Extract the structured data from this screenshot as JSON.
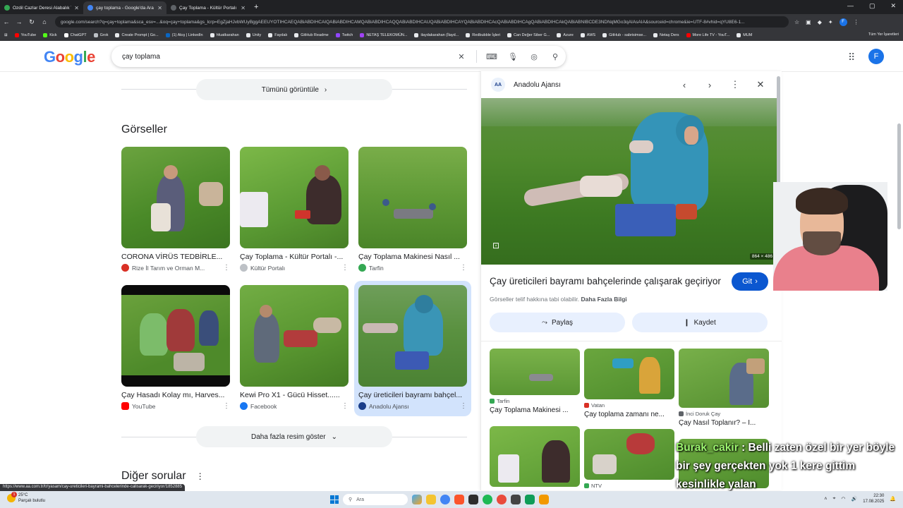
{
  "browser": {
    "tabs": [
      {
        "title": "Özdil Cazlar Deresi Alabalık Te...",
        "color": "#34a853",
        "active": false
      },
      {
        "title": "çay toplama - Google'da Ara",
        "color": "#4285f4",
        "active": true
      },
      {
        "title": "Çay Toplama - Kültür Portalı - T...",
        "color": "#202124",
        "active": false
      }
    ],
    "url": "google.com/search?q=çay+toplama&sca_esv=...&oq=çay+toplama&gs_lcrp=EgZjaHJvbWUyBggAEEUYOTIHCAEQABiABDIHCAIQABiABDIHCAMQABiABDIHCAQQABiABDIHCAUQABiABDIHCAYQABiABDIHCAcQABiABDIHCAgQABiABDIHCAkQABiABNIBCDE3NDNqMGo3qAIAsAIA&sourceid=chrome&ie=UTF-8#vhid=qYU8E6-1...",
    "bookmarks": [
      "YouTube",
      "Kick",
      "ChatGPT",
      "Grok",
      "Create Prompt | Go...",
      "(1) Akış | LinkedIn",
      "hfuatkarahan",
      "Unity",
      "Faydalı",
      "GitHub Readme",
      "Twitch",
      "NETAŞ TELEKOMÜN...",
      "ilaydakarahan (İlayd...",
      "Redbubble İşleri",
      "Can Değer Siber G...",
      "Azure",
      "AWS",
      "GitHub - sabrisimse...",
      "Netaş Ders",
      "More Life TV - YouT...",
      "MUM"
    ],
    "bookmarks_right": "Tüm Yer İşaretleri",
    "status_url": "https://www.aa.com.tr/tr/yasam/cay-ureticileri-bayrami-bahcelerinde-calisarak-geciriyor/1852885"
  },
  "google": {
    "logo": [
      "G",
      "o",
      "o",
      "g",
      "l",
      "e"
    ],
    "logo_colors": [
      "#4285f4",
      "#ea4335",
      "#fbbc05",
      "#4285f4",
      "#34a853",
      "#ea4335"
    ],
    "query": "çay toplama",
    "avatar_letter": "F"
  },
  "main": {
    "show_all": "Tümünü görüntüle",
    "section_title": "Görseller",
    "images": [
      {
        "caption": "CORONA VİRÜS TEDBİRLE...",
        "source": "Rize İl Tarım ve Orman M...",
        "source_color": "#d93025",
        "selected": false
      },
      {
        "caption": "Çay Toplama - Kültür Portalı -...",
        "source": "Kültür Portalı",
        "source_color": "#9aa0a6",
        "selected": false
      },
      {
        "caption": "Çay Toplama Makinesi Nasıl ...",
        "source": "Tarfin",
        "source_color": "#34a853",
        "selected": false
      },
      {
        "caption": "Çay Hasadı Kolay mı, Harves...",
        "source": "YouTube",
        "source_color": "#ff0000",
        "selected": false
      },
      {
        "caption": "Kewi Pro X1 - Gücü Hisset......",
        "source": "Facebook",
        "source_color": "#1877f2",
        "selected": false
      },
      {
        "caption": "Çay üreticileri bayramı bahçel...",
        "source": "Anadolu Ajansı",
        "source_color": "#1a3e8a",
        "selected": true
      }
    ],
    "more_images": "Daha fazla resim göster",
    "other_questions": "Diğer sorular"
  },
  "panel": {
    "source": "Anadolu Ajansı",
    "source_logo": "AA",
    "image_dims": "864 × 486",
    "title": "Çay üreticileri bayramı bahçelerinde çalışarak geçiriyor",
    "visit_label": "Git",
    "copyright": "Görseller telif hakkına tabi olabilir.",
    "more_info": "Daha Fazla Bilgi",
    "share_label": "Paylaş",
    "save_label": "Kaydet",
    "related": [
      {
        "source": "Tarfin",
        "caption": "Çay Toplama Makinesi ...",
        "source_color": "#34a853"
      },
      {
        "source": "Vatan",
        "caption": "Çay toplama zamanı ne...",
        "source_color": "#d93025"
      },
      {
        "source": "İnci Doruk Çay",
        "caption": "Çay Nasıl Toplanır? – İ...",
        "source_color": "#5f6368"
      },
      {
        "source": "",
        "caption": "",
        "source_color": "#5f6368"
      },
      {
        "source": "NTV",
        "caption": "",
        "source_color": "#34a853"
      },
      {
        "source": "",
        "caption": "",
        "source_color": "#5f6368"
      }
    ]
  },
  "overlay": {
    "chat_user": "Burak_cakir",
    "chat_message": " : Belli zaten özel bir yer böyle bir şey gerçekten yok 1 kere gittim kesinlikle yalan"
  },
  "taskbar": {
    "temperature": "25°C",
    "weather": "Parçalı bulutlu",
    "weather_badge": "1",
    "search_placeholder": "Ara",
    "time": "22:30",
    "date": "17.08.2025"
  }
}
